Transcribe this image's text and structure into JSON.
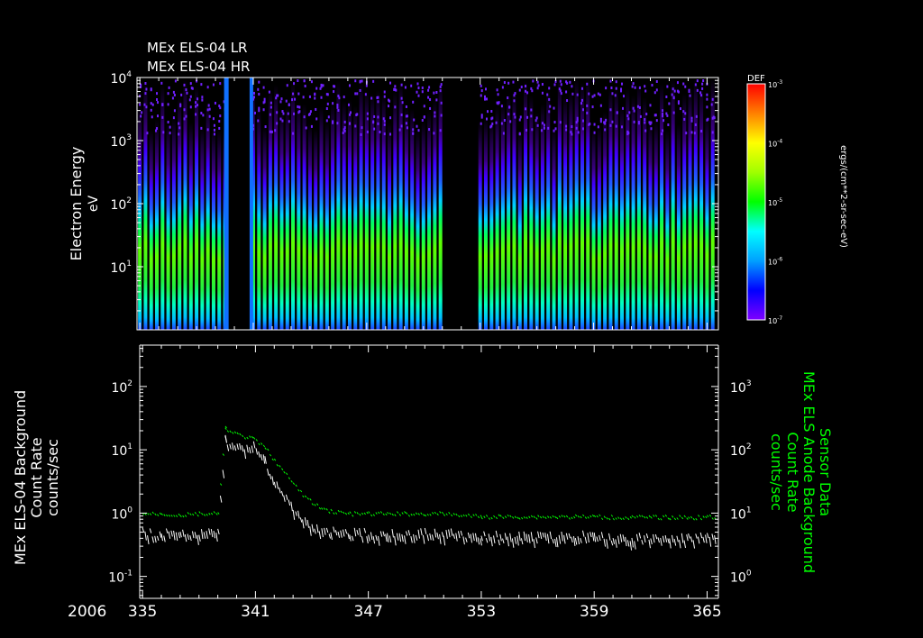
{
  "chart_data": [
    {
      "type": "heatmap",
      "title_lines": [
        "MEx ELS-04 LR",
        "MEx ELS-04 HR"
      ],
      "ylabel": "Electron Energy",
      "yunit": "eV",
      "yscale": "log",
      "ylim": [
        1,
        10000
      ],
      "ytick_labels": [
        {
          "value": 10000,
          "base": "10",
          "exp": "4"
        },
        {
          "value": 1000,
          "base": "10",
          "exp": "3"
        },
        {
          "value": 100,
          "base": "10",
          "exp": "2"
        },
        {
          "value": 10,
          "base": "10",
          "exp": "1"
        }
      ],
      "xlim": [
        334.85,
        365.6
      ],
      "orbit_period_days": 0.3,
      "data_gaps": [
        [
          339.6,
          340.9
        ],
        [
          351.2,
          352.8
        ]
      ],
      "colorbar": {
        "label": "DEF",
        "unit": "ergs/(cm**2-sr-sec-eV)",
        "scale": "log",
        "range": [
          1e-07,
          0.001
        ],
        "tick_labels": [
          {
            "base": "10",
            "exp": "-3"
          },
          {
            "base": "10",
            "exp": "-4"
          },
          {
            "base": "10",
            "exp": "-5"
          },
          {
            "base": "10",
            "exp": "-6"
          },
          {
            "base": "10",
            "exp": "-7"
          }
        ],
        "colors": [
          "#7f00ff",
          "#0000ff",
          "#00a0ff",
          "#00ffff",
          "#00ff00",
          "#a0ff00",
          "#ffff00",
          "#ff8000",
          "#ff0000"
        ]
      }
    },
    {
      "type": "line",
      "ylabel_left": [
        "MEx ELS-04 Background",
        "Count Rate",
        "counts/sec"
      ],
      "ylabel_right": [
        "Sensor Data",
        "MEx ELS Anode Background",
        "Count Rate",
        "counts/sec"
      ],
      "yscale": "log",
      "ylim_left": [
        0.045,
        450
      ],
      "ylim_right": [
        0.45,
        4500
      ],
      "left_tick_labels": [
        {
          "value": 100,
          "base": "10",
          "exp": "2"
        },
        {
          "value": 10,
          "base": "10",
          "exp": "1"
        },
        {
          "value": 1,
          "base": "10",
          "exp": "0"
        },
        {
          "value": 0.1,
          "base": "10",
          "exp": "-1"
        }
      ],
      "right_tick_labels": [
        {
          "value": 1000,
          "base": "10",
          "exp": "3"
        },
        {
          "value": 100,
          "base": "10",
          "exp": "2"
        },
        {
          "value": 10,
          "base": "10",
          "exp": "1"
        },
        {
          "value": 1,
          "base": "10",
          "exp": "0"
        }
      ],
      "xlim": [
        334.85,
        365.6
      ],
      "x_year_label": "2006",
      "x_tick_labels": [
        "335",
        "341",
        "347",
        "353",
        "359",
        "365"
      ],
      "x_tick_values": [
        335,
        341,
        347,
        353,
        359,
        365
      ],
      "series": [
        {
          "name": "ELS-04 background",
          "axis": "left",
          "color": "#ffffff",
          "points": [
            [
              335,
              0.5
            ],
            [
              336,
              0.5
            ],
            [
              337,
              0.48
            ],
            [
              338,
              0.5
            ],
            [
              339,
              0.5
            ],
            [
              339.4,
              20
            ],
            [
              339.5,
              12
            ],
            [
              340.9,
              12
            ],
            [
              341.5,
              7
            ],
            [
              342,
              3.5
            ],
            [
              342.5,
              2
            ],
            [
              343,
              1.2
            ],
            [
              343.5,
              0.8
            ],
            [
              344,
              0.6
            ],
            [
              345,
              0.55
            ],
            [
              346,
              0.5
            ],
            [
              347,
              0.5
            ],
            [
              348,
              0.5
            ],
            [
              349,
              0.48
            ],
            [
              350,
              0.5
            ],
            [
              351,
              0.5
            ],
            [
              353,
              0.45
            ],
            [
              354,
              0.45
            ],
            [
              355,
              0.45
            ],
            [
              356,
              0.45
            ],
            [
              357,
              0.45
            ],
            [
              358,
              0.45
            ],
            [
              359,
              0.45
            ],
            [
              360,
              0.42
            ],
            [
              361,
              0.42
            ],
            [
              362,
              0.42
            ],
            [
              363,
              0.42
            ],
            [
              364,
              0.42
            ],
            [
              365,
              0.42
            ],
            [
              365.4,
              0.42
            ]
          ]
        },
        {
          "name": "Anode background",
          "axis": "right",
          "color": "#00ff00",
          "points": [
            [
              335,
              10
            ],
            [
              336,
              10
            ],
            [
              337,
              9.5
            ],
            [
              338,
              10
            ],
            [
              339,
              10
            ],
            [
              339.4,
              250
            ],
            [
              339.5,
              200
            ],
            [
              340.9,
              150
            ],
            [
              341.5,
              110
            ],
            [
              342,
              70
            ],
            [
              342.5,
              45
            ],
            [
              343,
              30
            ],
            [
              343.5,
              20
            ],
            [
              344,
              15
            ],
            [
              344.5,
              12
            ],
            [
              345,
              11
            ],
            [
              346,
              10
            ],
            [
              347,
              10
            ],
            [
              348,
              10
            ],
            [
              349,
              10
            ],
            [
              350,
              10
            ],
            [
              351,
              10
            ],
            [
              353,
              9
            ],
            [
              354,
              9
            ],
            [
              355,
              9
            ],
            [
              356,
              9
            ],
            [
              357,
              9
            ],
            [
              358,
              9
            ],
            [
              359,
              9
            ],
            [
              360,
              8.8
            ],
            [
              361,
              8.8
            ],
            [
              362,
              8.8
            ],
            [
              363,
              8.8
            ],
            [
              364,
              8.8
            ],
            [
              365,
              8.8
            ],
            [
              365.4,
              9
            ]
          ]
        }
      ]
    }
  ]
}
